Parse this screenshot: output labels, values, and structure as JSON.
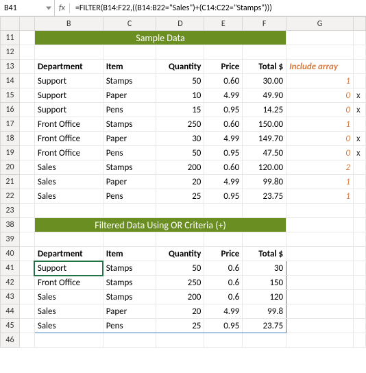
{
  "nameBox": "B41",
  "fx": "fx",
  "formula": "=FILTER(B14:F22,((B14:B22=\"Sales\")+(C14:C22=\"Stamps\")))",
  "columns": [
    "A",
    "B",
    "C",
    "D",
    "E",
    "F",
    "G"
  ],
  "rowNums1": [
    "11",
    "12",
    "13",
    "14",
    "15",
    "16",
    "17",
    "18",
    "19",
    "20",
    "21",
    "22",
    "23"
  ],
  "rowNums2": [
    "38",
    "39",
    "40",
    "41",
    "42",
    "43",
    "44",
    "45",
    "46"
  ],
  "section1": "Sample Data",
  "section2": "Filtered Data Using OR Criteria (+)",
  "headers": {
    "dept": "Department",
    "item": "Item",
    "qty": "Quantity",
    "price": "Price",
    "total": "Total $",
    "inc": "Include array"
  },
  "data1": [
    {
      "dept": "Support",
      "item": "Stamps",
      "qty": "50",
      "price": "0.60",
      "total": "30.00",
      "inc": "1",
      "x": ""
    },
    {
      "dept": "Support",
      "item": "Paper",
      "qty": "10",
      "price": "4.99",
      "total": "49.90",
      "inc": "0",
      "x": "x"
    },
    {
      "dept": "Support",
      "item": "Pens",
      "qty": "15",
      "price": "0.95",
      "total": "14.25",
      "inc": "0",
      "x": "x"
    },
    {
      "dept": "Front Office",
      "item": "Stamps",
      "qty": "250",
      "price": "0.60",
      "total": "150.00",
      "inc": "1",
      "x": ""
    },
    {
      "dept": "Front Office",
      "item": "Paper",
      "qty": "30",
      "price": "4.99",
      "total": "149.70",
      "inc": "0",
      "x": "x"
    },
    {
      "dept": "Front Office",
      "item": "Pens",
      "qty": "50",
      "price": "0.95",
      "total": "47.50",
      "inc": "0",
      "x": "x"
    },
    {
      "dept": "Sales",
      "item": "Stamps",
      "qty": "200",
      "price": "0.60",
      "total": "120.00",
      "inc": "2",
      "x": ""
    },
    {
      "dept": "Sales",
      "item": "Paper",
      "qty": "20",
      "price": "4.99",
      "total": "99.80",
      "inc": "1",
      "x": ""
    },
    {
      "dept": "Sales",
      "item": "Pens",
      "qty": "25",
      "price": "0.95",
      "total": "23.75",
      "inc": "1",
      "x": ""
    }
  ],
  "data2": [
    {
      "dept": "Support",
      "item": "Stamps",
      "qty": "50",
      "price": "0.6",
      "total": "30"
    },
    {
      "dept": "Front Office",
      "item": "Stamps",
      "qty": "250",
      "price": "0.6",
      "total": "150"
    },
    {
      "dept": "Sales",
      "item": "Stamps",
      "qty": "200",
      "price": "0.6",
      "total": "120"
    },
    {
      "dept": "Sales",
      "item": "Paper",
      "qty": "20",
      "price": "4.99",
      "total": "99.8"
    },
    {
      "dept": "Sales",
      "item": "Pens",
      "qty": "25",
      "price": "0.95",
      "total": "23.75"
    }
  ]
}
